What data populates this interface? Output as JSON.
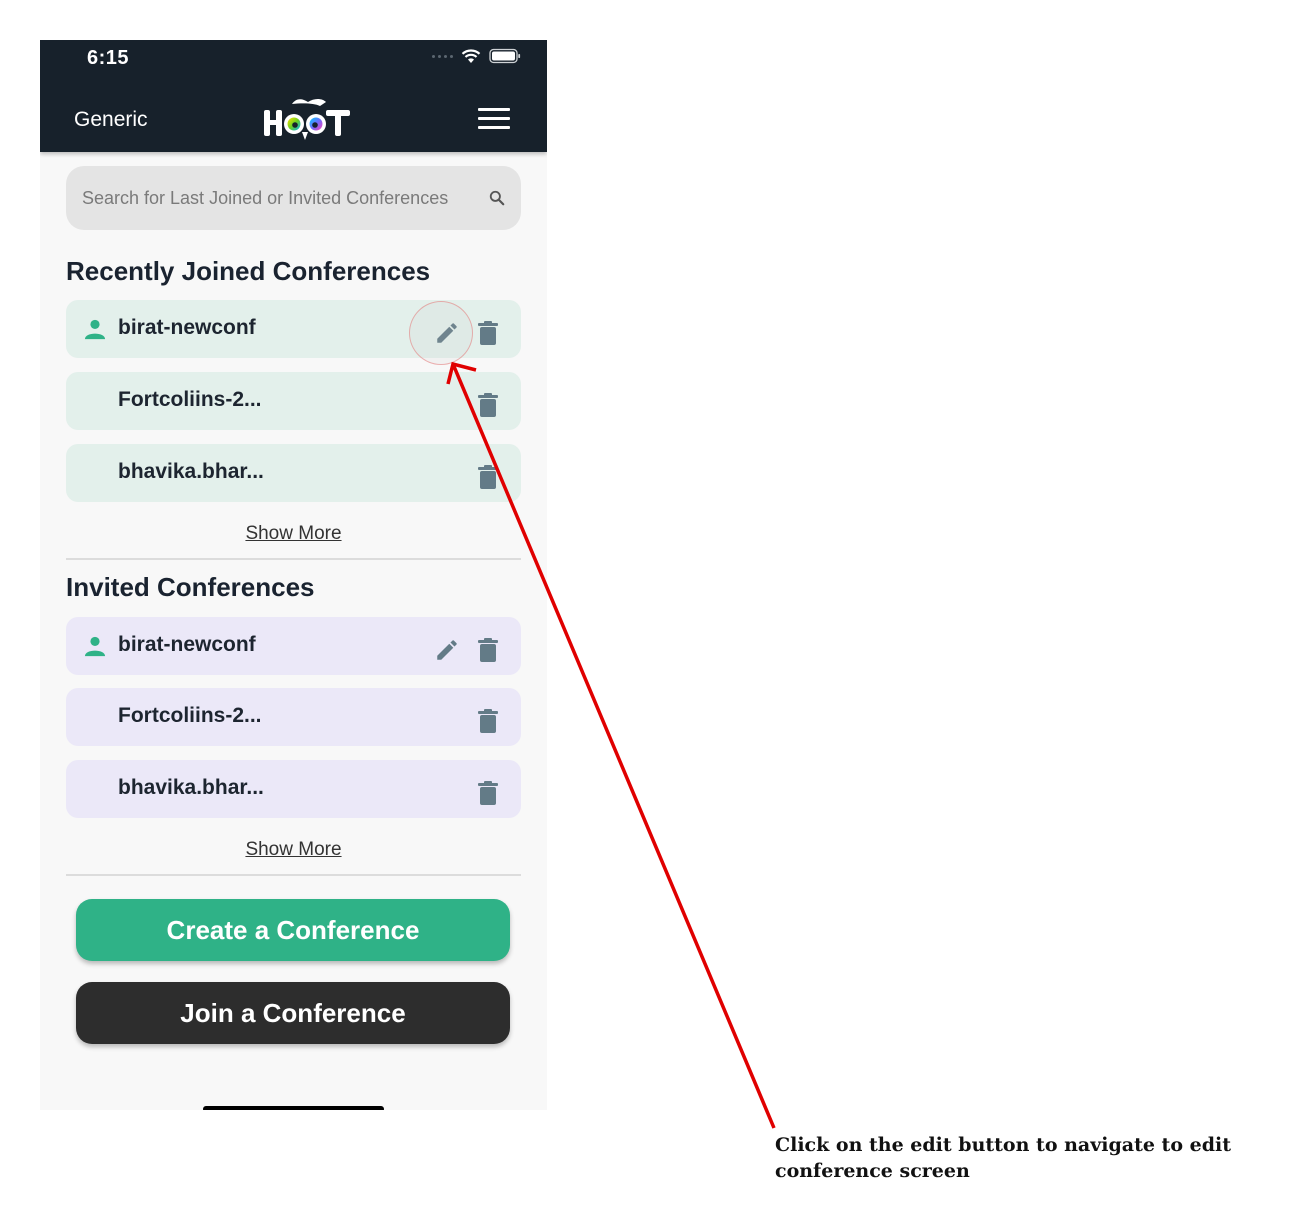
{
  "status_bar": {
    "time": "6:15"
  },
  "header": {
    "title": "Generic",
    "logo_text": "HOOT",
    "menu_icon": "hamburger-menu-icon"
  },
  "search": {
    "placeholder": "Search for Last Joined or Invited Conferences",
    "value": "",
    "icon": "search-icon"
  },
  "recently_joined": {
    "title": "Recently Joined Conferences",
    "items": [
      {
        "name": "birat-newconf",
        "owner": true,
        "editable": true
      },
      {
        "name": "Fortcoliins-2...",
        "owner": false,
        "editable": false
      },
      {
        "name": "bhavika.bhar...",
        "owner": false,
        "editable": false
      }
    ],
    "show_more": "Show More"
  },
  "invited": {
    "title": "Invited Conferences",
    "items": [
      {
        "name": "birat-newconf",
        "owner": true,
        "editable": true
      },
      {
        "name": "Fortcoliins-2...",
        "owner": false,
        "editable": false
      },
      {
        "name": "bhavika.bhar...",
        "owner": false,
        "editable": false
      }
    ],
    "show_more": "Show More"
  },
  "actions": {
    "create": "Create a Conference",
    "join": "Join a Conference"
  },
  "colors": {
    "header_bg": "#17212b",
    "accent_green": "#2fb287",
    "joined_card_bg": "#e3f0eb",
    "invited_card_bg": "#ebe8f8",
    "icon_gray": "#637b87",
    "join_button_bg": "#2d2d2d",
    "annotation_red": "#e00000"
  },
  "annotation": {
    "text": "Click on the edit button to navigate to edit conference screen"
  }
}
